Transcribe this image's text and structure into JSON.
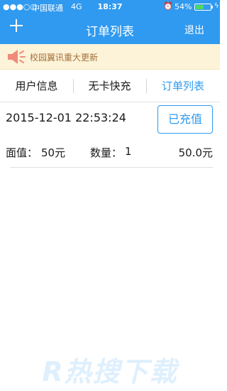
{
  "status_bar": {
    "signal": "●●●○○",
    "carrier": "中国联通",
    "network": "4G",
    "time": "18:37",
    "alarm_icon": "alarm-clock-icon",
    "battery_pct": "54%",
    "battery_level": 0.54,
    "charging_icon": "charging-bolt-icon"
  },
  "nav": {
    "add_icon": "plus-icon",
    "title": "订单列表",
    "logout_label": "退出"
  },
  "notice": {
    "icon": "speaker-icon",
    "text": "校园翼讯重大更新"
  },
  "tabs": [
    {
      "label": "用户信息",
      "active": false
    },
    {
      "label": "无卡快充",
      "active": false
    },
    {
      "label": "订单列表",
      "active": true
    }
  ],
  "order": {
    "datetime": "2015-12-01 22:53:24",
    "status_button": "已充值",
    "face_value_label": "面值：",
    "face_value": "50元",
    "quantity_label": "数量：",
    "quantity": "1",
    "amount": "50.0元"
  },
  "watermark": "R热搜下载",
  "colors": {
    "accent": "#2f9af0",
    "notice_bg": "#fdf3d8",
    "notice_text": "#a3703b",
    "speaker": "#f08a7a"
  }
}
